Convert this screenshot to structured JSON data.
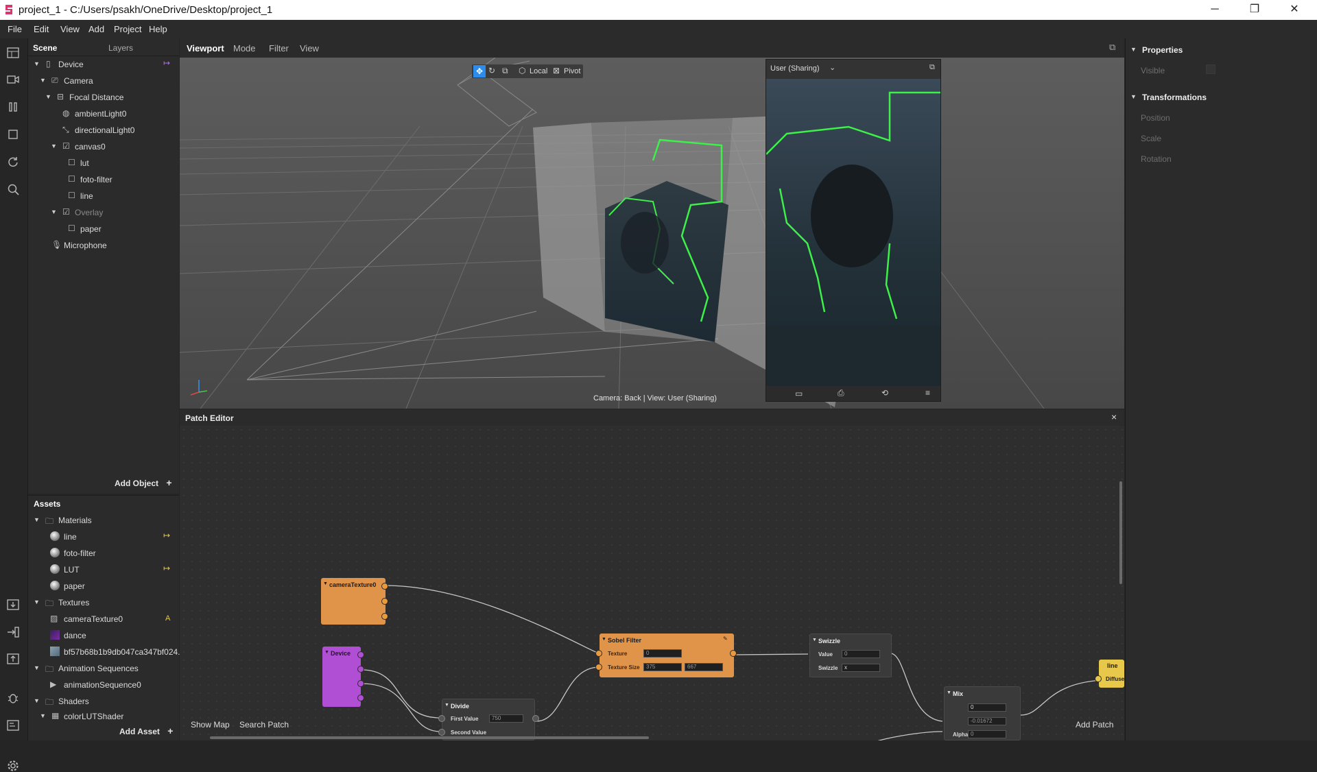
{
  "window": {
    "title": "project_1 - C:/Users/psakh/OneDrive/Desktop/project_1",
    "minimize": "─",
    "restore": "❐",
    "close": "✕"
  },
  "menu": [
    "File",
    "Edit",
    "View",
    "Add",
    "Project",
    "Help"
  ],
  "scene": {
    "tab_scene": "Scene",
    "tab_layers": "Layers",
    "items": [
      "Device",
      "Camera",
      "Focal Distance",
      "ambientLight0",
      "directionalLight0",
      "canvas0",
      "lut",
      "foto-filter",
      "line",
      "Overlay",
      "paper",
      "Microphone"
    ],
    "add_object": "Add Object"
  },
  "assets": {
    "title": "Assets",
    "items": [
      "Materials",
      "line",
      "foto-filter",
      "LUT",
      "paper",
      "Textures",
      "cameraTexture0",
      "dance",
      "bf57b68b1b9db047ca347bf024...",
      "Animation Sequences",
      "animationSequence0",
      "Shaders",
      "colorLUTShader"
    ],
    "badge": "A",
    "add_asset": "Add Asset"
  },
  "viewport": {
    "tabs": [
      "Viewport",
      "Mode",
      "Filter",
      "View"
    ],
    "local": "Local",
    "pivot": "Pivot",
    "preview_select": "User (Sharing)",
    "status": "Camera: Back | View: User (Sharing)"
  },
  "properties": {
    "title": "Properties",
    "visible": "Visible",
    "transformations": "Transformations",
    "position": "Position",
    "scale": "Scale",
    "rotation": "Rotation"
  },
  "patch": {
    "title": "Patch Editor",
    "close": "×",
    "show_map": "Show Map",
    "search_patch": "Search Patch",
    "add_patch": "Add Patch",
    "nodes": {
      "camera": "cameraTexture0",
      "device": "Device",
      "sobel": "Sobel Filter",
      "texture": "Texture",
      "texture_size": "Texture Size",
      "tex_val": "0",
      "size_w": "375",
      "size_h": "667",
      "swizzle": "Swizzle",
      "value": "Value",
      "value_v": "0",
      "swizzle_lbl": "Swizzle",
      "swizzle_v": "x",
      "divide": "Divide",
      "first_value": "First Value",
      "first_v": "750",
      "second_value": "Second Value",
      "mix": "Mix",
      "mix_v1": "0",
      "mix_v2": "-0.01672",
      "alpha": "Alpha",
      "alpha_v": "0",
      "line": "line",
      "diffuse": "Diffuse"
    }
  },
  "colors": {
    "accent": "#2d8ceb",
    "patch_orange": "#e0944a",
    "patch_purple": "#b04fd4",
    "patch_yellow": "#e8c84a",
    "edge_green": "#3ef04a"
  }
}
